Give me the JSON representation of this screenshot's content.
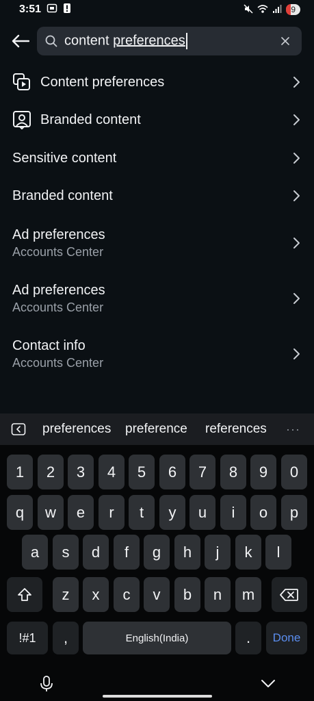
{
  "status_bar": {
    "time": "3:51",
    "battery": "9"
  },
  "search": {
    "value_plain": "content ",
    "value_underlined": "preferences"
  },
  "results": [
    {
      "title": "Content preferences",
      "subtitle": "",
      "icon": "content-preferences-icon"
    },
    {
      "title": "Branded content",
      "subtitle": "",
      "icon": "branded-content-icon"
    },
    {
      "title": "Sensitive content",
      "subtitle": ""
    },
    {
      "title": "Branded content",
      "subtitle": ""
    },
    {
      "title": "Ad preferences",
      "subtitle": "Accounts Center"
    },
    {
      "title": "Ad preferences",
      "subtitle": "Accounts Center"
    },
    {
      "title": "Contact info",
      "subtitle": "Accounts Center"
    }
  ],
  "suggestions": [
    "preferences",
    "preference",
    "references"
  ],
  "suggestions_more": "···",
  "keyboard": {
    "row_numbers": [
      "1",
      "2",
      "3",
      "4",
      "5",
      "6",
      "7",
      "8",
      "9",
      "0"
    ],
    "row1": [
      "q",
      "w",
      "e",
      "r",
      "t",
      "y",
      "u",
      "i",
      "o",
      "p"
    ],
    "row2": [
      "a",
      "s",
      "d",
      "f",
      "g",
      "h",
      "j",
      "k",
      "l"
    ],
    "row3": [
      "z",
      "x",
      "c",
      "v",
      "b",
      "n",
      "m"
    ],
    "symbols": "!#1",
    "comma": ",",
    "space": "English(India)",
    "period": ".",
    "done": "Done"
  },
  "colors": {
    "background": "#0b1014",
    "search_box": "#272c33",
    "key": "#2e3135",
    "done": "#5b8ef0",
    "battery_alert": "#e0403a"
  }
}
